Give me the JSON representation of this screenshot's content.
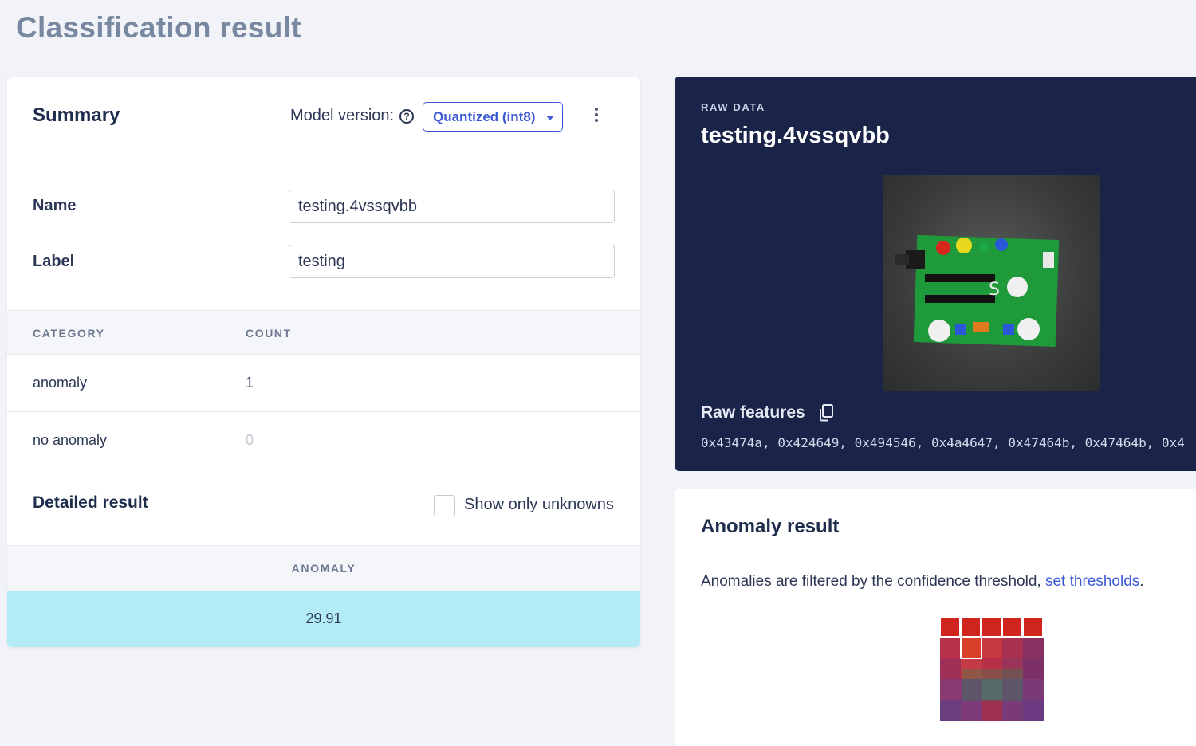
{
  "page": {
    "title": "Classification result"
  },
  "summary": {
    "title": "Summary",
    "model_version_label": "Model version:",
    "model_version_value": "Quantized (int8)",
    "fields": {
      "name_label": "Name",
      "name_value": "testing.4vssqvbb",
      "label_label": "Label",
      "label_value": "testing"
    },
    "table": {
      "headers": [
        "CATEGORY",
        "COUNT"
      ],
      "rows": [
        {
          "category": "anomaly",
          "count": "1"
        },
        {
          "category": "no anomaly",
          "count": "0"
        }
      ]
    },
    "detailed": {
      "title": "Detailed result",
      "checkbox_label": "Show only unknowns",
      "checkbox_checked": false,
      "column_header": "ANOMALY",
      "value": "29.91",
      "highlight_color": "#b3ecf7"
    }
  },
  "raw_data": {
    "kicker": "RAW DATA",
    "title": "testing.4vssqvbb",
    "features_label": "Raw features",
    "features_values": "0x43474a, 0x424649, 0x494546, 0x4a4647, 0x47464b, 0x47464b, 0x4",
    "background_color": "#1a2449"
  },
  "anomaly_result": {
    "title": "Anomaly result",
    "description_prefix": "Anomalies are filtered by the confidence threshold, ",
    "description_link": "set thresholds",
    "description_suffix": "."
  },
  "colors": {
    "accent": "#3d5ad6",
    "page_background": "#f1f3f8",
    "title_gray": "#7888a0"
  },
  "icons": [
    "help-circle-icon",
    "caret-down-icon",
    "kebab-menu-icon",
    "copy-icon",
    "checkbox-icon"
  ]
}
